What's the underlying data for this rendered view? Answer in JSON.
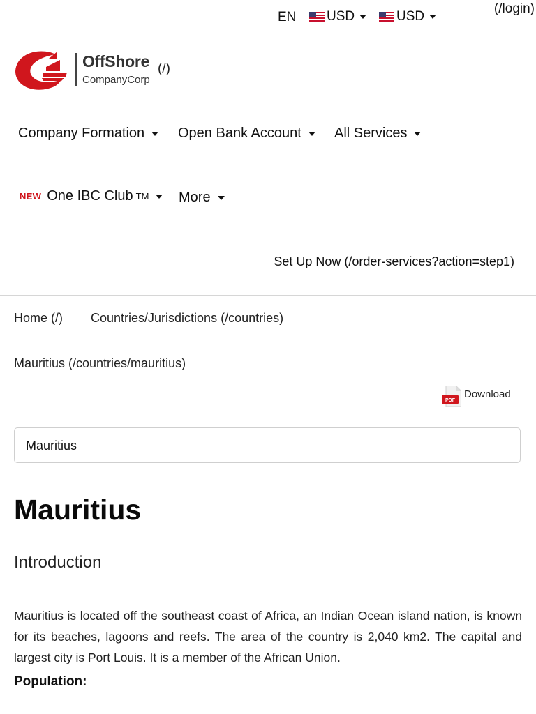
{
  "header": {
    "language": "EN",
    "currency_1": "USD",
    "currency_2": "USD",
    "login_link": "(/login)"
  },
  "logo": {
    "name": "OffShore",
    "subname": "CompanyCorp",
    "link": "(/)",
    "brand_color": "#d0161d"
  },
  "nav": {
    "items": [
      {
        "label": "Company Formation"
      },
      {
        "label": "Open Bank Account"
      },
      {
        "label": "All Services"
      },
      {
        "badge": "NEW",
        "label": "One IBC Club",
        "sup": "TM"
      },
      {
        "label": "More"
      }
    ],
    "setup_link": "Set Up Now (/order-services?action=step1)"
  },
  "breadcrumb": {
    "home": "Home (/)",
    "countries": "Countries/Jurisdictions (/countries)",
    "current": "Mauritius (/countries/mauritius)"
  },
  "download": {
    "icon_text": "PDF",
    "label": "Download"
  },
  "country_select": {
    "value": "Mauritius"
  },
  "content": {
    "title": "Mauritius",
    "section_title": "Introduction",
    "paragraph": "Mauritius is located off the southeast coast of Africa, an Indian Ocean island nation, is known for its beaches, lagoons and reefs. The area of the country is 2,040 km2. The capital and largest city is Port Louis. It is a member of the African Union.",
    "population_heading": "Population:"
  }
}
